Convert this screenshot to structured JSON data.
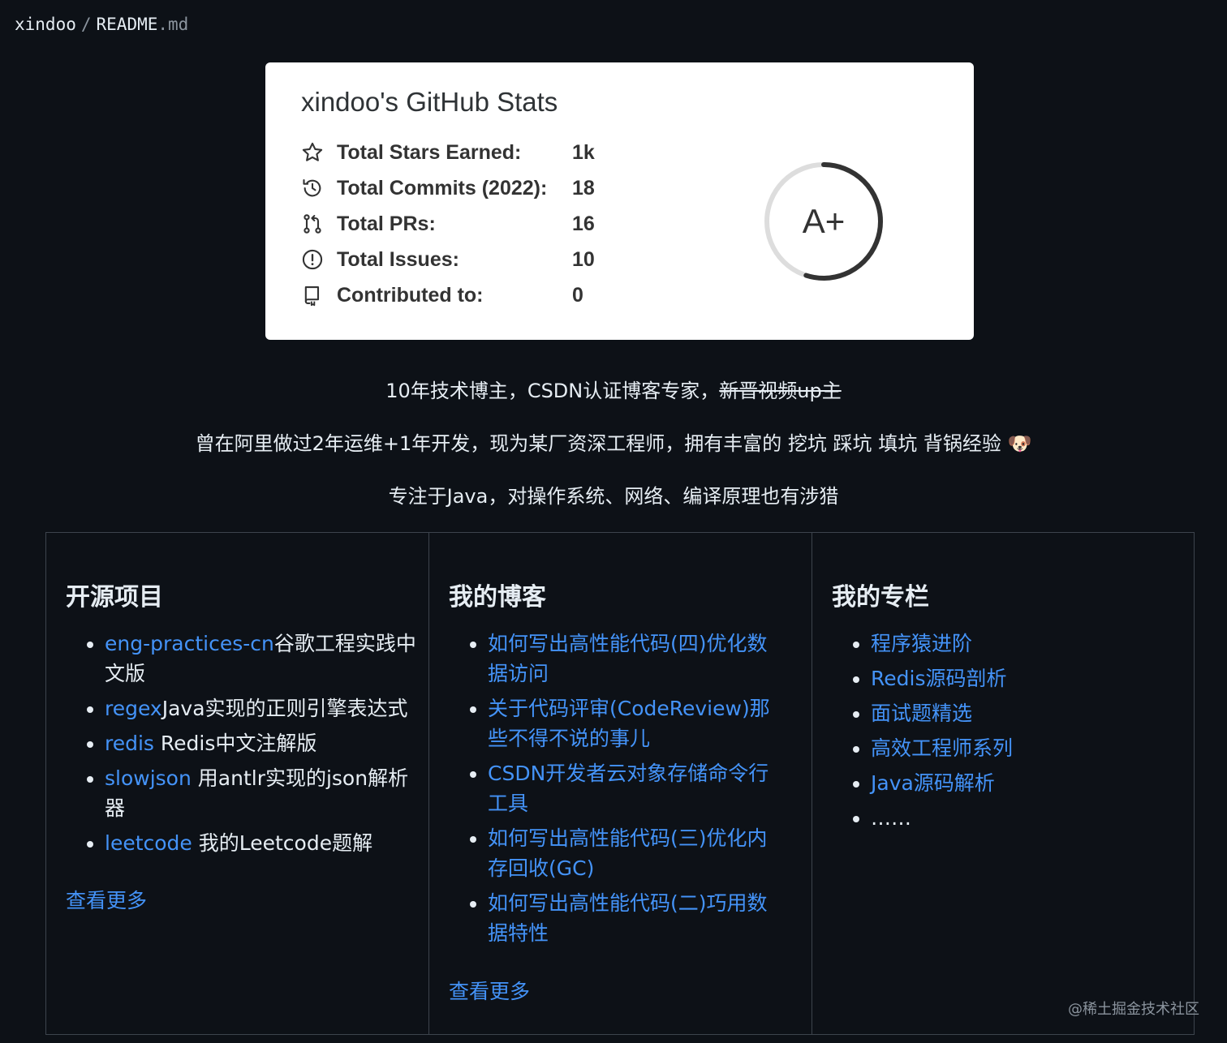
{
  "breadcrumb": {
    "owner": "xindoo",
    "separator": "/",
    "file": "README",
    "ext": ".md"
  },
  "stats": {
    "title": "xindoo's GitHub Stats",
    "rows": [
      {
        "icon": "star-icon",
        "label": "Total Stars Earned:",
        "value": "1k"
      },
      {
        "icon": "history-icon",
        "label": "Total Commits (2022):",
        "value": "18"
      },
      {
        "icon": "pull-request-icon",
        "label": "Total PRs:",
        "value": "16"
      },
      {
        "icon": "issue-icon",
        "label": "Total Issues:",
        "value": "10"
      },
      {
        "icon": "repo-icon",
        "label": "Contributed to:",
        "value": "0"
      }
    ],
    "rank": "A+",
    "rank_progress": 0.55
  },
  "intro": {
    "line1": "10年技术博主，CSDN认证博客专家，",
    "line1_strike": "新晋视频up主",
    "line2": "曾在阿里做过2年运维+1年开发，现为某厂资深工程师，拥有丰富的 挖坑 踩坑 填坑 背锅经验 🐶",
    "line3": "专注于Java，对操作系统、网络、编译原理也有涉猎"
  },
  "columns": {
    "projects": {
      "title": "开源项目",
      "items": [
        {
          "link": "eng-practices-cn",
          "text": "谷歌工程实践中文版"
        },
        {
          "link": "regex",
          "text": "Java实现的正则引擎表达式"
        },
        {
          "link": "redis",
          "text": " Redis中文注解版"
        },
        {
          "link": "slowjson",
          "text": " 用antlr实现的json解析器"
        },
        {
          "link": "leetcode",
          "text": " 我的Leetcode题解"
        }
      ],
      "more": "查看更多"
    },
    "blog": {
      "title": "我的博客",
      "items": [
        "如何写出高性能代码(四)优化数据访问",
        "关于代码评审(CodeReview)那些不得不说的事儿",
        "CSDN开发者云对象存储命令行工具",
        "如何写出高性能代码(三)优化内存回收(GC)",
        "如何写出高性能代码(二)巧用数据特性"
      ],
      "more": "查看更多"
    },
    "columns": {
      "title": "我的专栏",
      "items": [
        "程序猿进阶",
        "Redis源码剖析",
        "面试题精选",
        "高效工程师系列",
        "Java源码解析"
      ],
      "tail": "……"
    }
  },
  "watermark": "@稀土掘金技术社区"
}
